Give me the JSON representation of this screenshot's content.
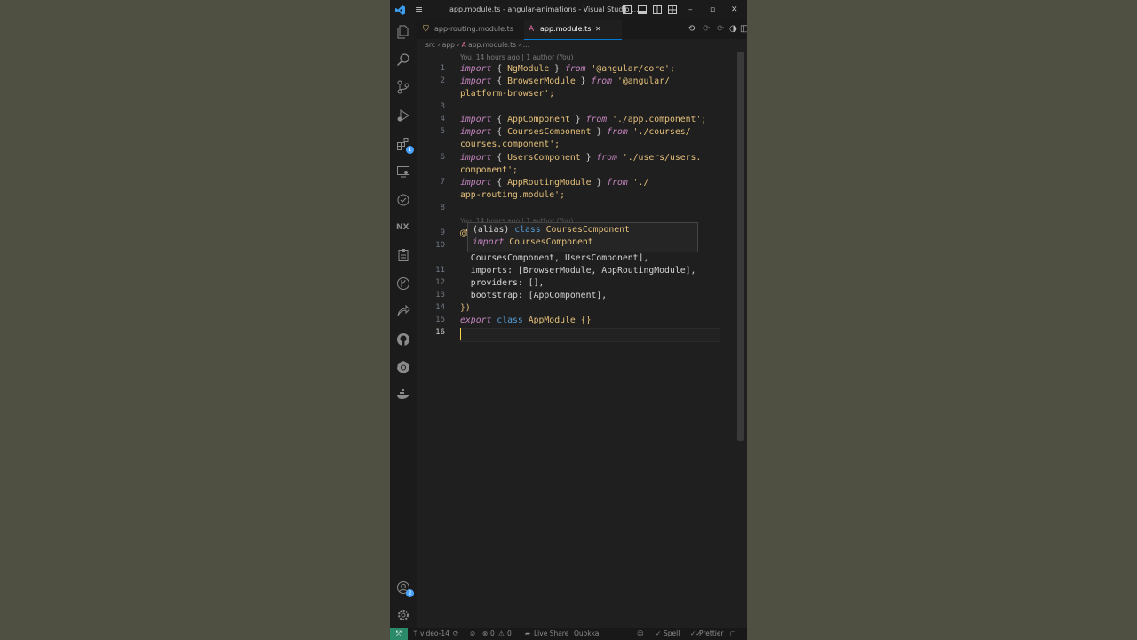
{
  "window": {
    "title": "app.module.ts - angular-animations - Visual Studio ...",
    "menu_icon": "hamburger-menu-icon",
    "logo": "vscode-logo",
    "controls": [
      "toggle-sidebar-icon",
      "toggle-panel-icon",
      "toggle-secondary-sidebar-icon",
      "customize-layout-icon",
      "minimize-icon",
      "maximize-icon",
      "close-icon"
    ]
  },
  "tabs": [
    {
      "label": "app-routing.module.ts",
      "icon": "typescript-file-icon",
      "active": false
    },
    {
      "label": "app.module.ts",
      "icon": "angular-icon",
      "active": true,
      "close": "✕"
    }
  ],
  "breadcrumb": [
    "src",
    "app",
    "app.module.ts",
    "..."
  ],
  "blame": {
    "line1": "You, 14 hours ago | 1 author (You)",
    "line9": "You, 14 hours ago | 1 author (You)"
  },
  "code": {
    "l1": {
      "n": "1",
      "a": "import",
      "b": " { ",
      "c": "NgModule",
      "d": " } ",
      "e": "from",
      "f": " '@angular/core';"
    },
    "l2": {
      "n": "2",
      "a": "import",
      "b": " { ",
      "c": "BrowserModule",
      "d": " } ",
      "e": "from",
      "f": " '@angular/"
    },
    "l2b": "platform-browser';",
    "l3": {
      "n": "3"
    },
    "l4": {
      "n": "4",
      "a": "import",
      "b": " { ",
      "c": "AppComponent",
      "d": " } ",
      "e": "from",
      "f": " './app.component';"
    },
    "l5": {
      "n": "5",
      "a": "import",
      "b": " { ",
      "c": "CoursesComponent",
      "d": " } ",
      "e": "from",
      "f": " './courses/"
    },
    "l5b": "courses.component';",
    "l6": {
      "n": "6",
      "a": "import",
      "b": " { ",
      "c": "UsersComponent",
      "d": " } ",
      "e": "from",
      "f": " './users/users."
    },
    "l6b": "component';",
    "l7": {
      "n": "7",
      "a": "import",
      "b": " { ",
      "c": "AppRoutingModule",
      "d": " } ",
      "e": "from",
      "f": " './"
    },
    "l7b": "app-routing.module';",
    "l8": {
      "n": "8"
    },
    "l9": {
      "n": "9",
      "text": "@N"
    },
    "l10": {
      "n": "10"
    },
    "l10b": "  CoursesComponent, UsersComponent],",
    "l11": {
      "n": "11",
      "k": "  imports",
      "v": ": [BrowserModule, AppRoutingModule],"
    },
    "l12": {
      "n": "12",
      "k": "  providers",
      "v": ": [],"
    },
    "l13": {
      "n": "13",
      "k": "  bootstrap",
      "v": ": [AppComponent],"
    },
    "l14": {
      "n": "14",
      "text": "})"
    },
    "l15": {
      "n": "15",
      "a": "export",
      "b": " ",
      "c": "class",
      "d": " ",
      "e": "AppModule",
      "f": " {}"
    },
    "l16": {
      "n": "16"
    }
  },
  "hover": {
    "line1_a": "(alias) ",
    "line1_b": "class",
    "line1_c": " CoursesComponent",
    "line2_a": "import",
    "line2_b": " CoursesComponent"
  },
  "activity_icons": [
    "explorer-icon",
    "search-icon",
    "source-control-icon",
    "run-debug-icon",
    "extensions-icon",
    "remote-explorer-icon",
    "testing-icon",
    "nx-icon",
    "clipboard-icon",
    "git-graph-icon",
    "live-share-icon",
    "github-icon",
    "kubernetes-icon",
    "docker-icon"
  ],
  "extensions_badge": "1",
  "accounts_badge": "2",
  "nx_label": "NX",
  "status": {
    "remote": "⤱",
    "branch": "video-14",
    "problems_errors": "0",
    "problems_warnings": "0",
    "live_share": "Live Share",
    "quokka": "Quokka",
    "spell": "Spell",
    "prettier": "Prettier"
  },
  "colors": {
    "accent": "#0078d4",
    "keyword": "#c586c0",
    "class_name": "#e5c07b",
    "cursor": "#f7d54a"
  }
}
